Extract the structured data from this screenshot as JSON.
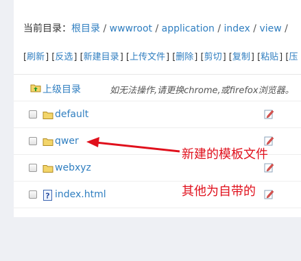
{
  "breadcrumb": {
    "label": "当前目录：",
    "items": [
      "根目录",
      "wwwroot",
      "application",
      "index",
      "view"
    ],
    "separator": " / ",
    "trailing": " /"
  },
  "toolbar": {
    "items": [
      "刷新",
      "反选",
      "新建目录",
      "上传文件",
      "删除",
      "剪切",
      "复制",
      "粘贴",
      "压"
    ]
  },
  "parent_row": {
    "label": "上级目录",
    "hint": "如无法操作,请更换chrome,或firefox浏览器。"
  },
  "files": [
    {
      "name": "default",
      "type": "folder"
    },
    {
      "name": "qwer",
      "type": "folder"
    },
    {
      "name": "webxyz",
      "type": "folder"
    },
    {
      "name": "index.html",
      "type": "file"
    }
  ],
  "annotations": {
    "new_template": "新建的模板文件",
    "builtin": "其他为自带的"
  },
  "colors": {
    "link": "#2f7ec0",
    "annotation": "#e0101c",
    "folder": "#f3d56a",
    "background": "#eef0f4"
  }
}
